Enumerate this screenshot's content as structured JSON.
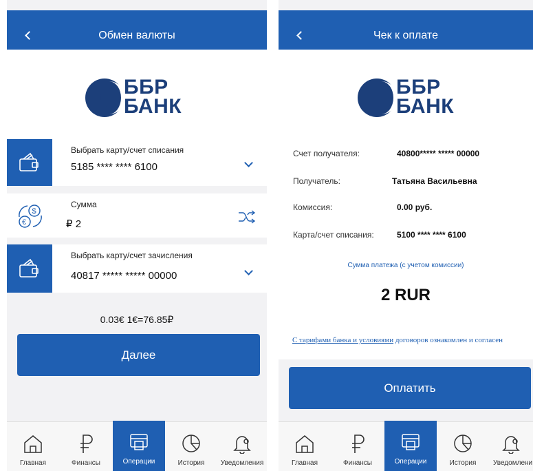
{
  "left": {
    "header": {
      "title": "Обмен валюты"
    },
    "logo": {
      "line1": "ББР",
      "line2": "БАНК"
    },
    "debit_card": {
      "label": "Выбрать карту/счет списания",
      "value": "5185 **** **** 6100",
      "icon": "wallet-icon"
    },
    "amount": {
      "label": "Сумма",
      "value": "₽ 2",
      "icon": "currency-exchange-icon",
      "swap_icon": "shuffle-icon"
    },
    "credit_card": {
      "label": "Выбрать карту/счет зачисления",
      "value": "40817 ***** ***** 00000",
      "icon": "wallet-icon"
    },
    "rate": "0.03€ 1€=76.85₽",
    "next_button": "Далее"
  },
  "right": {
    "header": {
      "title": "Чек к оплате"
    },
    "logo": {
      "line1": "ББР",
      "line2": "БАНК"
    },
    "details": [
      {
        "key": "Счет получателя:",
        "value": "40800***** ***** 00000"
      },
      {
        "key": "Получатель:",
        "value": "Татьяна Васильевна"
      },
      {
        "key": "Комиссия:",
        "value": "0.00 руб."
      },
      {
        "key": "Карта/счет списания:",
        "value": "5100 **** **** 6100"
      }
    ],
    "payment_caption": "Сумма платежа (с учетом комиссии)",
    "payment_amount": "2 RUR",
    "terms": {
      "link1": "С тарифами банка и условиями",
      "link2": "договоров ознакомлен и согласен"
    },
    "pay_button": "Оплатить"
  },
  "nav": {
    "items": [
      {
        "label": "Главная",
        "icon": "home-icon"
      },
      {
        "label": "Финансы",
        "icon": "ruble-icon"
      },
      {
        "label": "Операции",
        "icon": "operations-icon",
        "active": true
      },
      {
        "label": "История",
        "icon": "pie-chart-icon"
      },
      {
        "label": "Уведомления",
        "icon": "bell-icon"
      }
    ],
    "right_last_label": "Уведомлени"
  },
  "colors": {
    "primary": "#1f5fb2",
    "logo_text": "#1c3f7a",
    "background": "#f2f2f4"
  }
}
